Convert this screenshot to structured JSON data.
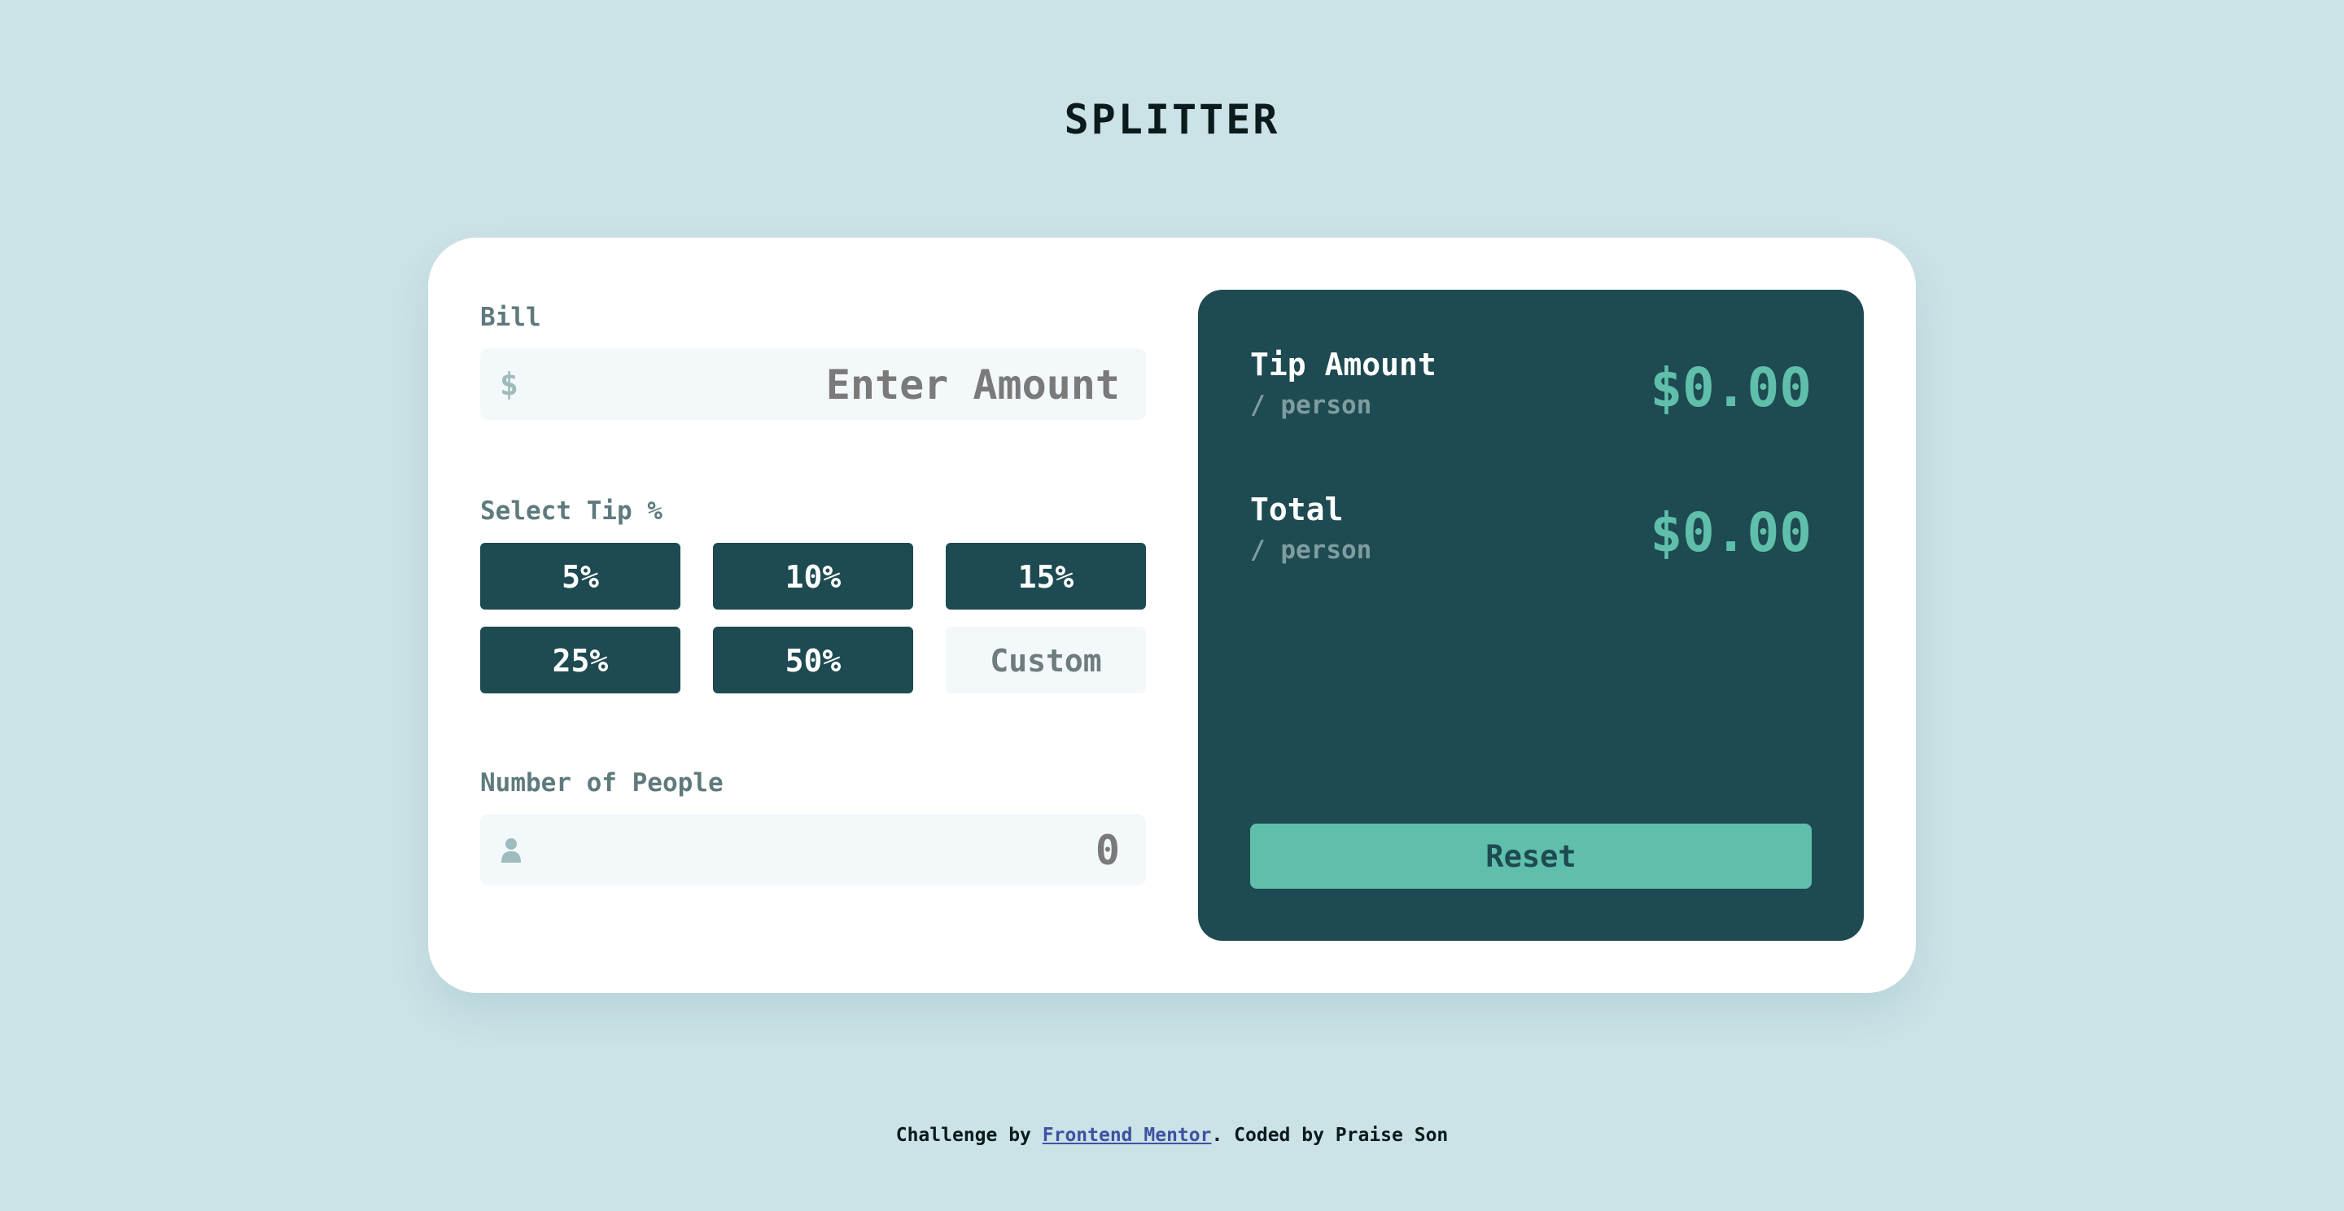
{
  "app": {
    "logo": "SPLITTER"
  },
  "bill": {
    "label": "Bill",
    "currency_symbol": "$",
    "placeholder": "Enter Amount"
  },
  "tip": {
    "label": "Select Tip %",
    "options": [
      "5%",
      "10%",
      "15%",
      "25%",
      "50%"
    ],
    "custom_placeholder": "Custom"
  },
  "people": {
    "label": "Number of People",
    "placeholder": "0",
    "icon": "person-icon"
  },
  "results": {
    "tip_amount": {
      "title": "Tip Amount",
      "sub": "/ person",
      "value": "$0.00"
    },
    "total": {
      "title": "Total",
      "sub": "/ person",
      "value": "$0.00"
    },
    "reset_label": "Reset"
  },
  "footer": {
    "prefix": "Challenge by ",
    "link_text": "Frontend Mentor",
    "suffix": ". Coded by Praise Son"
  },
  "colors": {
    "background": "#cbe2e6",
    "dark_teal": "#1e4a51",
    "accent": "#5fbfab",
    "input_bg": "#f3f8fb"
  }
}
